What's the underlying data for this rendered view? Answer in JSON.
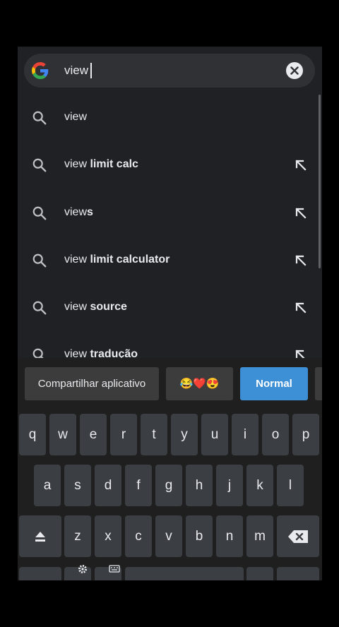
{
  "search": {
    "query": "view",
    "suggestions": [
      {
        "prefix": "view",
        "bold": "",
        "has_arrow": false
      },
      {
        "prefix": "view ",
        "bold": "limit calc",
        "has_arrow": true
      },
      {
        "prefix": "view",
        "bold": "s",
        "has_arrow": true
      },
      {
        "prefix": "view ",
        "bold": "limit calculator",
        "has_arrow": true
      },
      {
        "prefix": "view ",
        "bold": "source",
        "has_arrow": true
      },
      {
        "prefix": "view ",
        "bold": "tradução",
        "has_arrow": true
      }
    ]
  },
  "keyboard": {
    "strip": {
      "share_label": "Compartilhar aplicativo",
      "emoji_label": "😂❤️😍",
      "mode_label": "Normal"
    },
    "row1": [
      "q",
      "w",
      "e",
      "r",
      "t",
      "y",
      "u",
      "i",
      "o",
      "p"
    ],
    "row2": [
      "a",
      "s",
      "d",
      "f",
      "g",
      "h",
      "j",
      "k",
      "l"
    ],
    "row3": [
      "z",
      "x",
      "c",
      "v",
      "b",
      "n",
      "m"
    ]
  },
  "colors": {
    "background": "#202124",
    "search_bar": "#303134",
    "key": "#3b3f44",
    "accent": "#3d8fd6"
  }
}
